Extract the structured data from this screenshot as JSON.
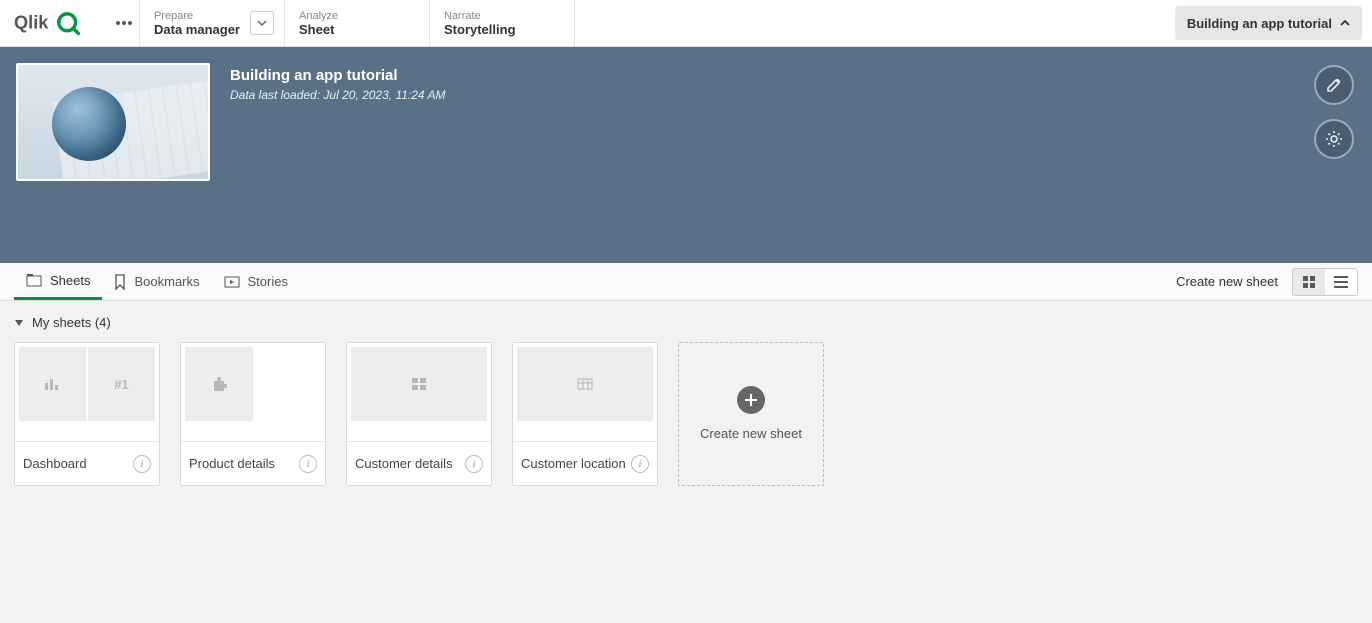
{
  "nav": {
    "prepare": {
      "category": "Prepare",
      "value": "Data manager"
    },
    "analyze": {
      "category": "Analyze",
      "value": "Sheet"
    },
    "narrate": {
      "category": "Narrate",
      "value": "Storytelling"
    }
  },
  "appToggle": {
    "label": "Building an app tutorial"
  },
  "hero": {
    "title": "Building an app tutorial",
    "subtitle": "Data last loaded: Jul 20, 2023, 11:24 AM"
  },
  "tabs": {
    "sheets": "Sheets",
    "bookmarks": "Bookmarks",
    "stories": "Stories",
    "createNew": "Create new sheet"
  },
  "section": {
    "title": "My sheets (4)"
  },
  "sheets": [
    {
      "title": "Dashboard"
    },
    {
      "title": "Product details"
    },
    {
      "title": "Customer details"
    },
    {
      "title": "Customer location"
    }
  ],
  "newCard": {
    "label": "Create new sheet"
  },
  "previewBadge": "#1"
}
